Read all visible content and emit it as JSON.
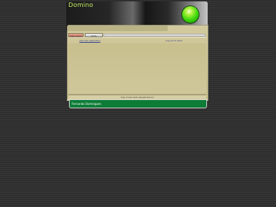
{
  "app": {
    "title": "Domino"
  },
  "tabs": [
    {
      "label": "Sign Inside"
    },
    {
      "label": "Sorts"
    }
  ],
  "panel": {
    "link_left": "Add new application",
    "link_right": "Log out of client",
    "footer": "Sign Inside Desk (Registrations)"
  },
  "status_bar": {
    "text": "Fernando Domingues"
  },
  "icons": {
    "orb": "status-orb-icon"
  },
  "colors": {
    "title": "#c6ec63",
    "status_bar": "#0d7c36",
    "panel": "#cbc292"
  }
}
